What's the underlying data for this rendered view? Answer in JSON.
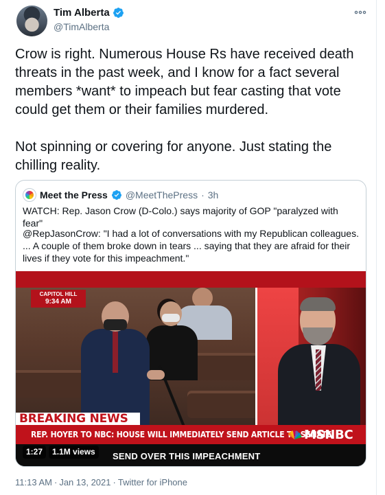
{
  "author": {
    "name": "Tim Alberta",
    "handle": "@TimAlberta",
    "verified": true
  },
  "more_icon": "more-horizontal-icon",
  "tweet_text": "Crow is right. Numerous House Rs have received death threats in the past week, and I know for a fact several members *want* to impeach but fear casting that vote could get them or their families murdered.\n\nNot spinning or covering for anyone. Just stating the chilling reality.",
  "quoted": {
    "name": "Meet the Press",
    "handle": "@MeetThePress",
    "separator": "·",
    "time": "3h",
    "text1": "WATCH: Rep. Jason Crow (D-Colo.) says majority of GOP \"paralyzed with fear\"",
    "text2": "@RepJasonCrow: \"I had a lot of conversations with my Republican colleagues. ... A couple of them broke down in tears ... saying that they are afraid for their lives if they vote for this impeachment.\"",
    "video": {
      "location_line1": "CAPITOL HILL",
      "location_line2": "9:34 AM",
      "breaking": "BREAKING NEWS",
      "banner": "REP. HOYER TO NBC: HOUSE WILL IMMEDIATELY SEND ARTICLE TO SENATE",
      "network": "MSNBC",
      "caption": "SEND OVER THIS IMPEACHMENT",
      "duration": "1:27",
      "views": "1.1M views"
    }
  },
  "meta": {
    "time": "11:13 AM",
    "separator1": "·",
    "date": "Jan 13, 2021",
    "separator2": "·",
    "source": "Twitter for iPhone"
  },
  "colors": {
    "verified": "#1da1f2",
    "msnbc_red": "#c0121b",
    "muted_text": "#5b7083"
  }
}
